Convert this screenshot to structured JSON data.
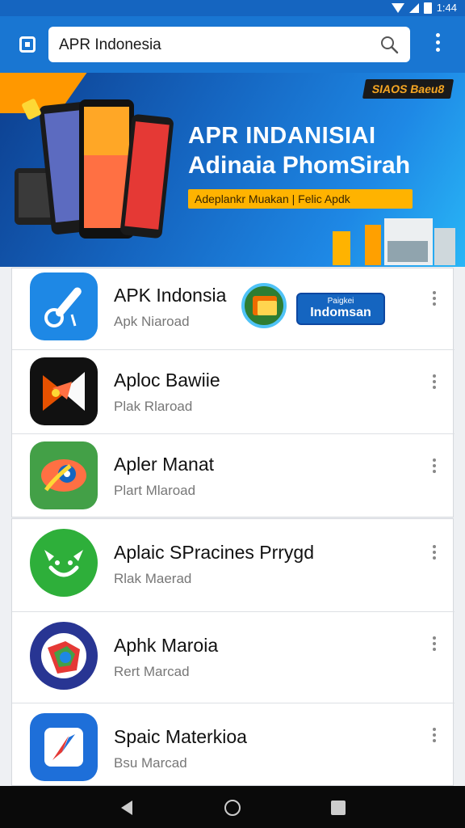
{
  "status_bar": {
    "time": "1:44"
  },
  "search": {
    "query": "APR Indonesia"
  },
  "banner": {
    "badge": "SIAOS Baeu8",
    "title_line1": "APR INDANISIAI",
    "title_line2": "Adinaia PhomSirah",
    "cta": "Adeplankr Muakan | Felic Apdk"
  },
  "promo": {
    "small": "Paigkei",
    "big": "Indomsan"
  },
  "apps": [
    {
      "name": "APK Indonsia",
      "sub": "Apk Niaroad",
      "icon": "wrench-app-icon",
      "color": "#1e88e5"
    },
    {
      "name": "Aploc Bawiie",
      "sub": "Plak Rlaroad",
      "icon": "bird-app-icon",
      "color": "#111111"
    },
    {
      "name": "Apler Manat",
      "sub": "Plart Mlaroad",
      "icon": "eye-app-icon",
      "color": "#43a047"
    },
    {
      "name": "Aplaic SPracines Prrygd",
      "sub": "Rlak Maerad",
      "icon": "smile-app-icon",
      "color": "#2eaf3a"
    },
    {
      "name": "Aphk Maroia",
      "sub": "Rert Marcad",
      "icon": "map-app-icon",
      "color": "#283593"
    },
    {
      "name": "Spaic Materkioa",
      "sub": "Bsu Marcad",
      "icon": "compass-app-icon",
      "color": "#1e6fd9"
    }
  ]
}
